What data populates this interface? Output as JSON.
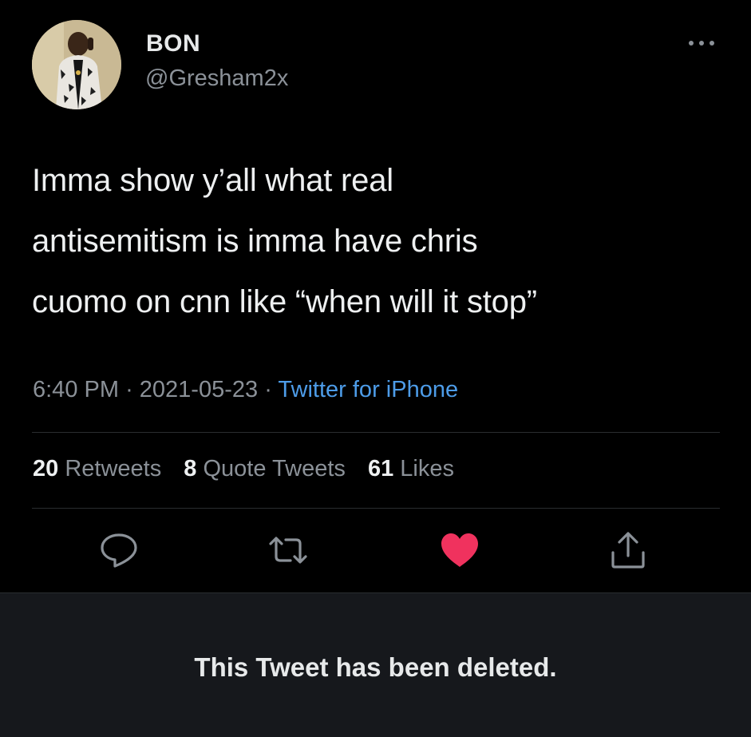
{
  "tweet": {
    "author": {
      "display_name": "BON",
      "handle": "@Gresham2x"
    },
    "text_lines": [
      "Imma show y’all what real",
      "antisemitism is imma have chris",
      "cuomo on cnn like “when will it stop”"
    ],
    "time": "6:40 PM",
    "separator": "·",
    "date": "2021-05-23",
    "source": "Twitter for iPhone",
    "stats": {
      "retweets_count": "20",
      "retweets_label": "Retweets",
      "quotes_count": "8",
      "quotes_label": "Quote Tweets",
      "likes_count": "61",
      "likes_label": "Likes"
    },
    "actions": {
      "reply_icon": "reply-icon",
      "retweet_icon": "retweet-icon",
      "like_icon": "heart-icon",
      "share_icon": "share-icon",
      "liked": true
    }
  },
  "deleted_notice": "This Tweet has been deleted.",
  "colors": {
    "background": "#000000",
    "link": "#4d9ce8",
    "like": "#f0325e",
    "muted": "#8b9198",
    "notice_bar": "#16181c"
  }
}
